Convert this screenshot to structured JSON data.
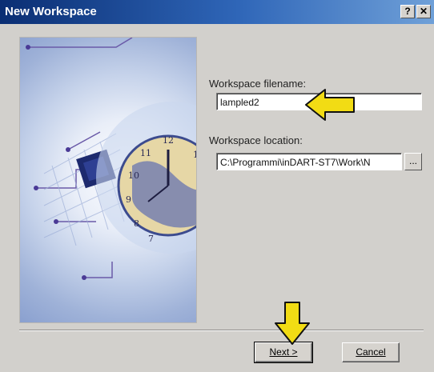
{
  "window": {
    "title": "New Workspace",
    "help_glyph": "?",
    "close_glyph": "✕"
  },
  "form": {
    "filename_label": "Workspace filename:",
    "filename_value": "lampled2",
    "location_label": "Workspace location:",
    "location_value": "C:\\Programmi\\inDART-ST7\\Work\\N",
    "browse_label": "..."
  },
  "buttons": {
    "next_label": "Next >",
    "cancel_label": "Cancel"
  },
  "colors": {
    "title_bar": "#0a2e73",
    "dialog": "#d2d0cc",
    "arrow": "#f2dc14"
  },
  "annotations": {
    "arrow_icons": [
      "arrow-left-icon",
      "arrow-down-icon"
    ]
  }
}
